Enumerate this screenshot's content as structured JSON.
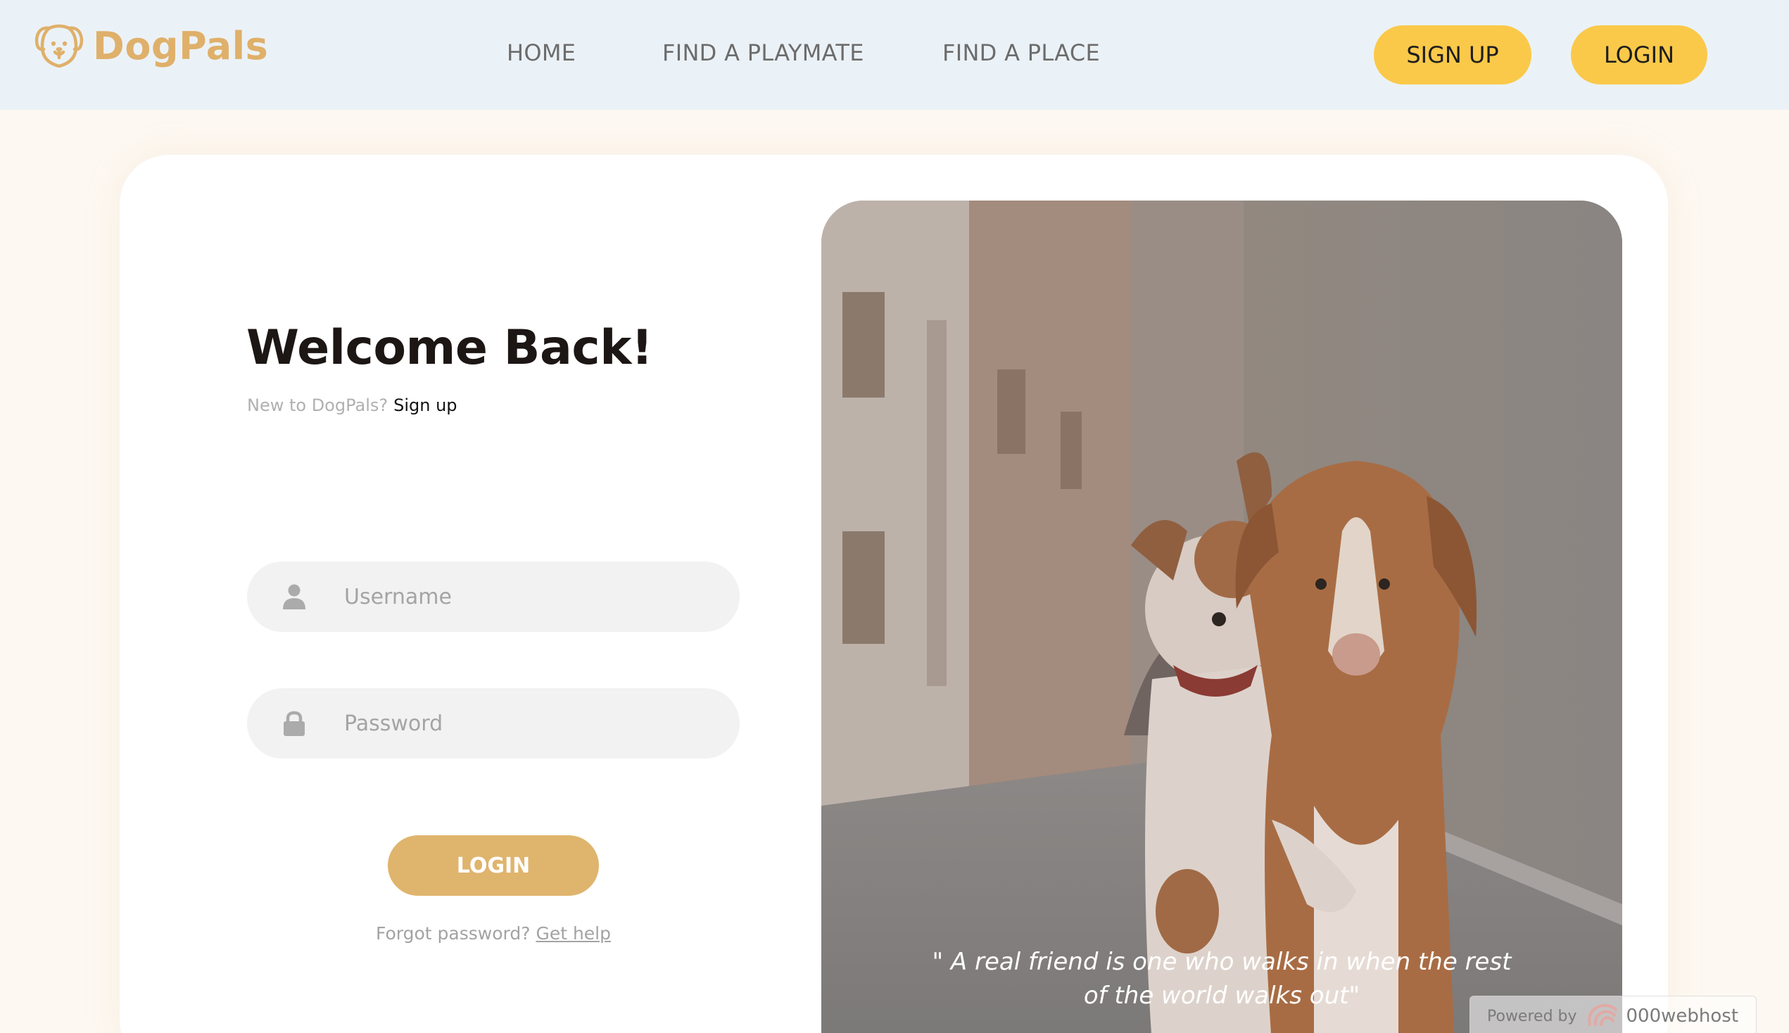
{
  "header": {
    "logo_text": "DogPals",
    "nav": [
      {
        "label": "HOME"
      },
      {
        "label": "FIND A PLAYMATE"
      },
      {
        "label": "FIND A PLACE"
      }
    ],
    "signup_label": "SIGN UP",
    "login_label": "LOGIN"
  },
  "login_form": {
    "title": "Welcome Back!",
    "new_prompt": "New to DogPals?",
    "signup_link": "Sign up",
    "username": {
      "placeholder": "Username",
      "value": "",
      "icon": "user-icon"
    },
    "password": {
      "placeholder": "Password",
      "value": "",
      "icon": "lock-icon"
    },
    "submit_label": "LOGIN",
    "forgot_text": "Forgot password?",
    "help_link": "Get help"
  },
  "hero": {
    "quote": "\" A real friend is one who walks in when the rest of the world walks out\""
  },
  "powered": {
    "prefix": "Powered by",
    "brand": "000webhost"
  },
  "colors": {
    "header_bg": "#ebf2f7",
    "brand": "#dfb06a",
    "header_button": "#fac94a",
    "login_button": "#dfb46d",
    "page_bg": "#fdf8f1",
    "input_bg": "#f2f2f2"
  }
}
